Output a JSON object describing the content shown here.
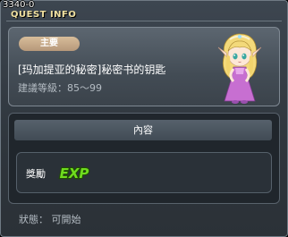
{
  "window": {
    "id_text": "3340-0",
    "title": "QUEST INFO"
  },
  "quest": {
    "tag": "主要",
    "name": "[玛加提亚的秘密]秘密书的钥匙",
    "level_text": "建議等級：85～99",
    "npc_icon": "elf-girl-npc-portrait"
  },
  "content": {
    "section_title": "內容",
    "reward_label": "獎勵",
    "reward_icon": "exp-icon",
    "reward_icon_text": "EXP"
  },
  "status": {
    "text": "狀態： 可開始"
  },
  "colors": {
    "title": "#f0e0a0",
    "tag_bg": "#c9ab88",
    "exp_green": "#6fdc1e"
  }
}
